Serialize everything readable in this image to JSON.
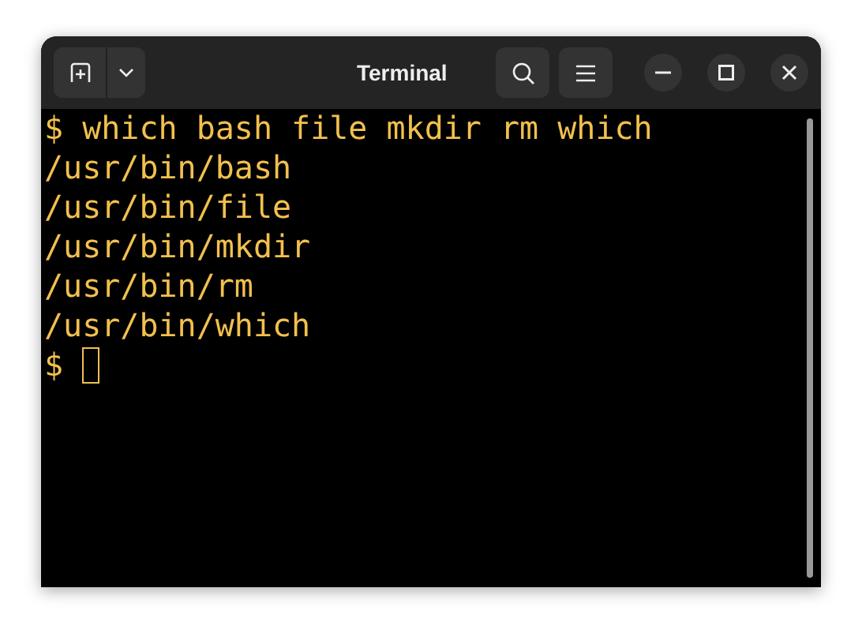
{
  "window": {
    "title": "Terminal"
  },
  "terminal": {
    "lines": [
      "$ which bash file mkdir rm which",
      "/usr/bin/bash",
      "/usr/bin/file",
      "/usr/bin/mkdir",
      "/usr/bin/rm",
      "/usr/bin/which"
    ],
    "prompt": "$"
  }
}
